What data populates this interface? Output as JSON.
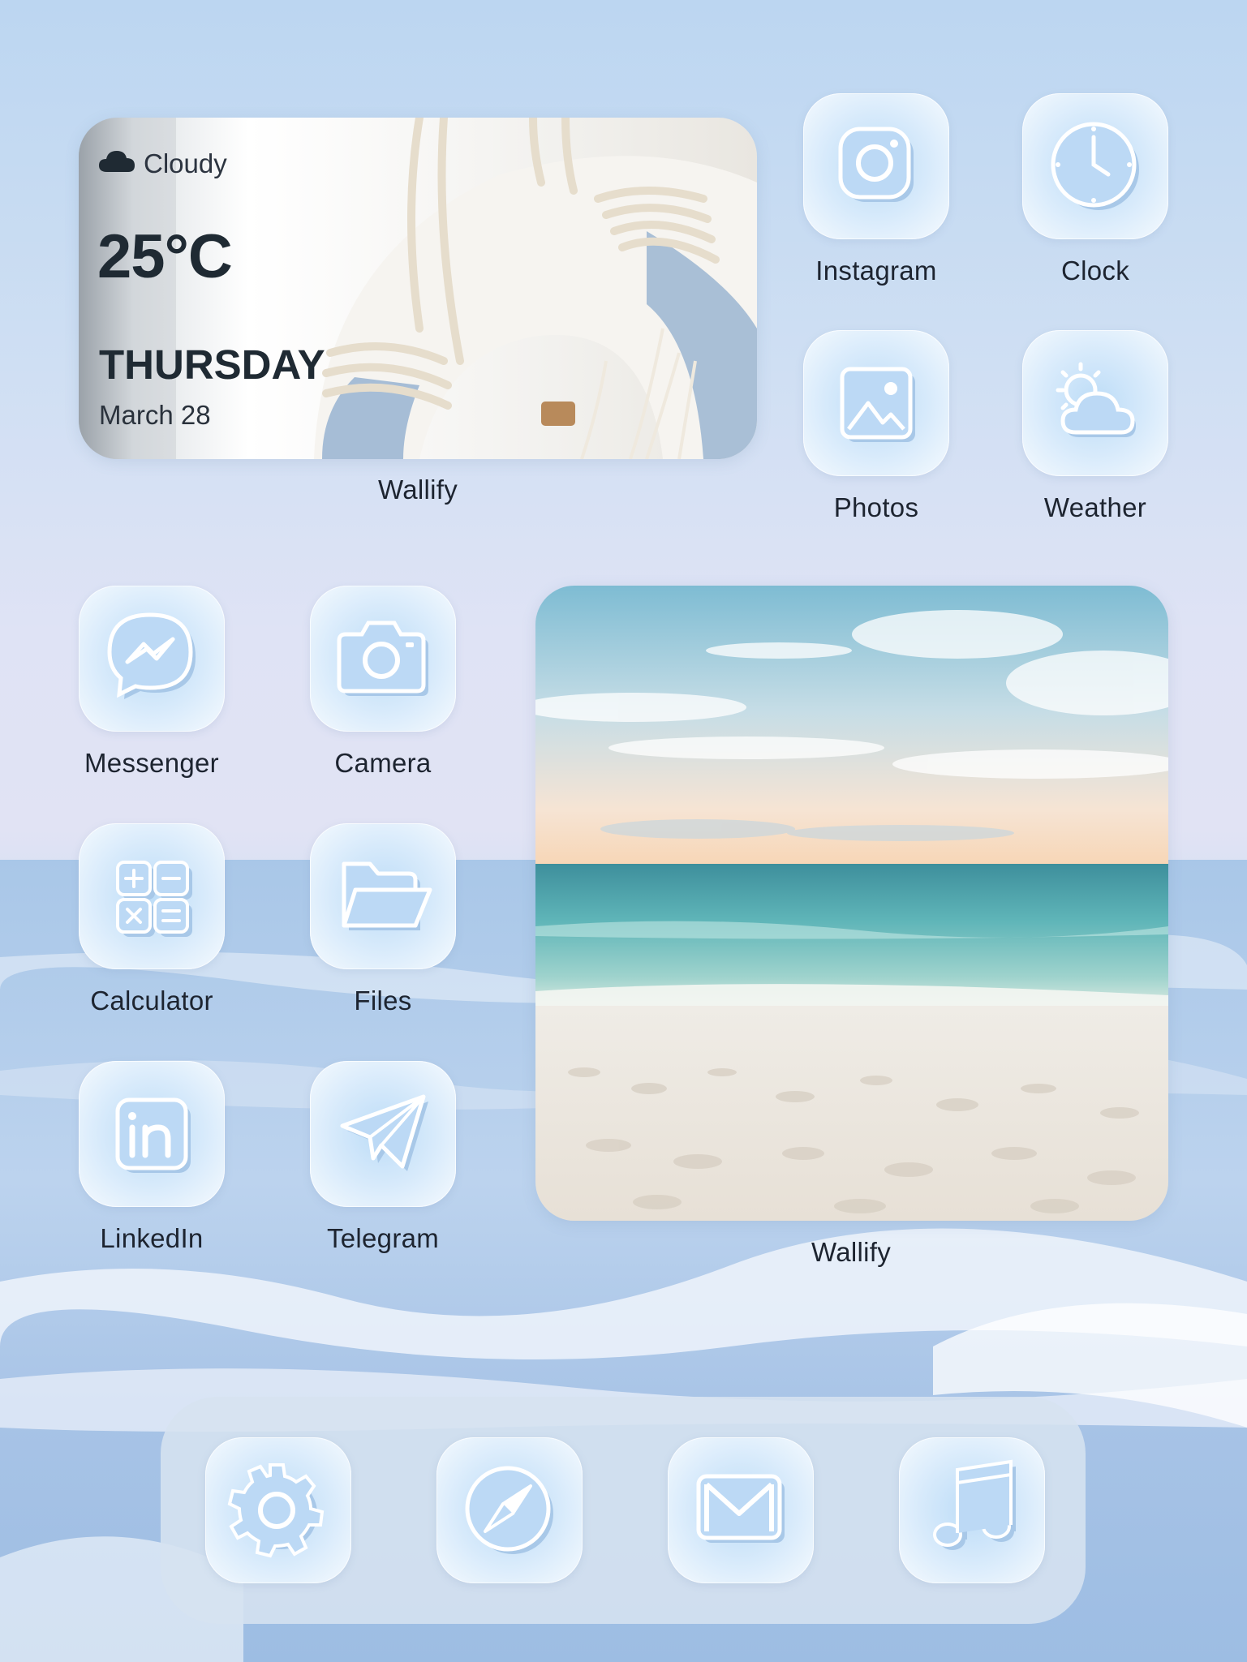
{
  "weather_widget": {
    "condition": "Cloudy",
    "condition_icon": "cloud-icon",
    "temperature": "25°C",
    "day": "THURSDAY",
    "date": "March 28",
    "label": "Wallify"
  },
  "photo_widget": {
    "label": "Wallify"
  },
  "apps": {
    "instagram": {
      "label": "Instagram",
      "icon": "instagram-icon"
    },
    "clock": {
      "label": "Clock",
      "icon": "clock-icon"
    },
    "photos": {
      "label": "Photos",
      "icon": "photos-icon"
    },
    "weather": {
      "label": "Weather",
      "icon": "weather-icon"
    },
    "messenger": {
      "label": "Messenger",
      "icon": "messenger-icon"
    },
    "camera": {
      "label": "Camera",
      "icon": "camera-icon"
    },
    "calculator": {
      "label": "Calculator",
      "icon": "calculator-icon"
    },
    "files": {
      "label": "Files",
      "icon": "folder-icon"
    },
    "linkedin": {
      "label": "LinkedIn",
      "icon": "linkedin-icon"
    },
    "telegram": {
      "label": "Telegram",
      "icon": "telegram-icon"
    }
  },
  "dock": [
    "gear-icon",
    "compass-icon",
    "mail-icon",
    "music-note-icon"
  ],
  "colors": {
    "icon_blue": "#b7d6f3",
    "icon_stroke": "#ffffff",
    "label_text": "#1d2430"
  }
}
